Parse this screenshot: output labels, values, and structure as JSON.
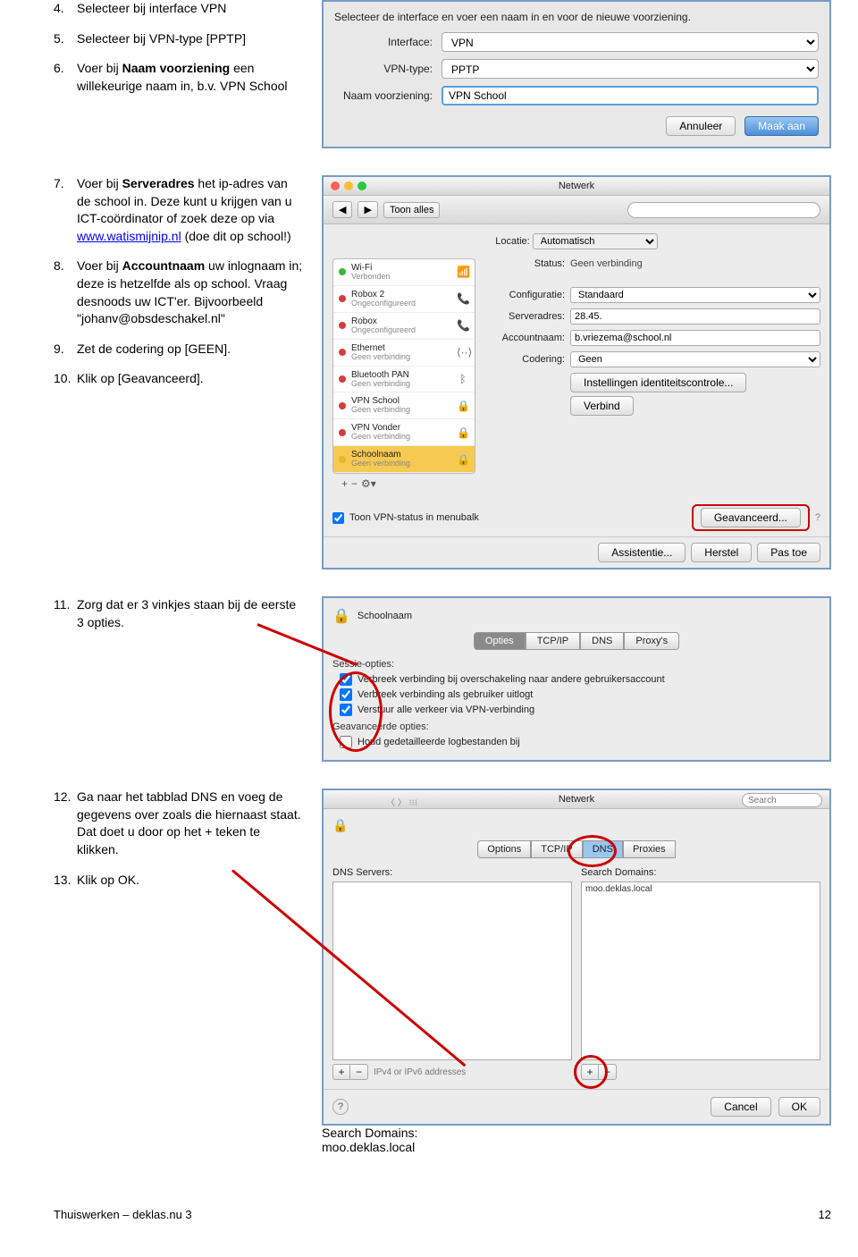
{
  "steps": {
    "s4": {
      "num": "4.",
      "txt_a": "Selecteer bij interface VPN"
    },
    "s5": {
      "num": "5.",
      "txt_a": "Selecteer bij VPN-type [PPTP]"
    },
    "s6": {
      "num": "6.",
      "txt_a": "Voer bij ",
      "bold": "Naam voorziening",
      "txt_b": " een willekeurige naam in, b.v. VPN School"
    },
    "s7": {
      "num": "7.",
      "txt_a": "Voer bij ",
      "bold": "Serveradres",
      "txt_b": " het ip-adres van de school in. Deze kunt u krijgen van u ICT-coördinator of zoek deze op via ",
      "link": "www.watismijnip.nl",
      "txt_c": " (doe dit op school!)"
    },
    "s8": {
      "num": "8.",
      "txt_a": "Voer bij ",
      "bold": "Accountnaam",
      "txt_b": " uw inlognaam in; deze is hetzelfde als op school. Vraag desnoods uw ICT'er. Bijvoorbeeld \"johanv@obsdeschakel.nl\""
    },
    "s9": {
      "num": "9.",
      "txt_a": "Zet de codering op [GEEN]."
    },
    "s10": {
      "num": "10.",
      "txt_a": "Klik op [Geavanceerd]."
    },
    "s11": {
      "num": "11.",
      "txt_a": "Zorg dat er 3 vinkjes staan bij de eerste 3 opties."
    },
    "s12": {
      "num": "12.",
      "txt_a": "Ga naar het tabblad DNS en voeg  de gegevens over zoals die hiernaast staat. Dat doet u door op het + teken te klikken."
    },
    "s13": {
      "num": "13.",
      "txt_a": "Klik op OK."
    }
  },
  "scr1": {
    "intro": "Selecteer de interface en voer een naam in en voor de nieuwe voorziening.",
    "lbl_interface": "Interface:",
    "val_interface": "VPN",
    "lbl_type": "VPN-type:",
    "val_type": "PPTP",
    "lbl_name": "Naam voorziening:",
    "val_name": "VPN School",
    "btn_cancel": "Annuleer",
    "btn_create": "Maak aan"
  },
  "scr2": {
    "title": "Netwerk",
    "toon_alles": "Toon alles",
    "locatie_lbl": "Locatie:",
    "locatie_val": "Automatisch",
    "services": [
      {
        "dot": "g",
        "name": "Wi-Fi",
        "sub": "Verbonden",
        "icon": "wifi"
      },
      {
        "dot": "r",
        "name": "Robox 2",
        "sub": "Ongeconfigureerd",
        "icon": "phone"
      },
      {
        "dot": "r",
        "name": "Robox",
        "sub": "Ongeconfigureerd",
        "icon": "phone"
      },
      {
        "dot": "r",
        "name": "Ethernet",
        "sub": "Geen verbinding",
        "icon": "eth"
      },
      {
        "dot": "r",
        "name": "Bluetooth PAN",
        "sub": "Geen verbinding",
        "icon": "bt"
      },
      {
        "dot": "r",
        "name": "VPN School",
        "sub": "Geen verbinding",
        "icon": "lock"
      },
      {
        "dot": "r",
        "name": "VPN Vonder",
        "sub": "Geen verbinding",
        "icon": "lock"
      },
      {
        "dot": "y",
        "name": "Schoolnaam",
        "sub": "Geen verbinding",
        "icon": "lock",
        "sel": true
      }
    ],
    "status_lbl": "Status:",
    "status_val": "Geen verbinding",
    "config_lbl": "Configuratie:",
    "config_val": "Standaard",
    "server_lbl": "Serveradres:",
    "server_val": "28.45.",
    "account_lbl": "Accountnaam:",
    "account_val": "b.vriezema@school.nl",
    "codering_lbl": "Codering:",
    "codering_val": "Geen",
    "btn_ident": "Instellingen identiteitscontrole...",
    "btn_verbind": "Verbind",
    "chk_menubalk": "Toon VPN-status in menubalk",
    "btn_adv": "Geavanceerd...",
    "btn_assist": "Assistentie...",
    "btn_herstel": "Herstel",
    "btn_pastoe": "Pas toe"
  },
  "scr3": {
    "name": "Schoolnaam",
    "tabs": [
      "Opties",
      "TCP/IP",
      "DNS",
      "Proxy's"
    ],
    "sect1": "Sessie-opties:",
    "opt1": "Verbreek verbinding bij overschakeling naar andere gebruikersaccount",
    "opt2": "Verbreek verbinding als gebruiker uitlogt",
    "opt3": "Verstuur alle verkeer via VPN-verbinding",
    "sect2": "Geavanceerde opties:",
    "opt4": "Houd gedetailleerde logbestanden bij"
  },
  "scr4": {
    "title": "Netwerk",
    "search": "Search",
    "tabs": [
      "Options",
      "TCP/IP",
      "DNS",
      "Proxies"
    ],
    "dns_lbl": "DNS Servers:",
    "search_lbl": "Search Domains:",
    "domain_val": "moo.deklas.local",
    "ipv_note": "IPv4 or IPv6 addresses",
    "btn_cancel": "Cancel",
    "btn_ok": "OK",
    "callout_hd": "Search Domains:",
    "callout_val": "moo.deklas.local"
  },
  "footer": {
    "left": "Thuiswerken – deklas.nu 3",
    "right": "12"
  }
}
